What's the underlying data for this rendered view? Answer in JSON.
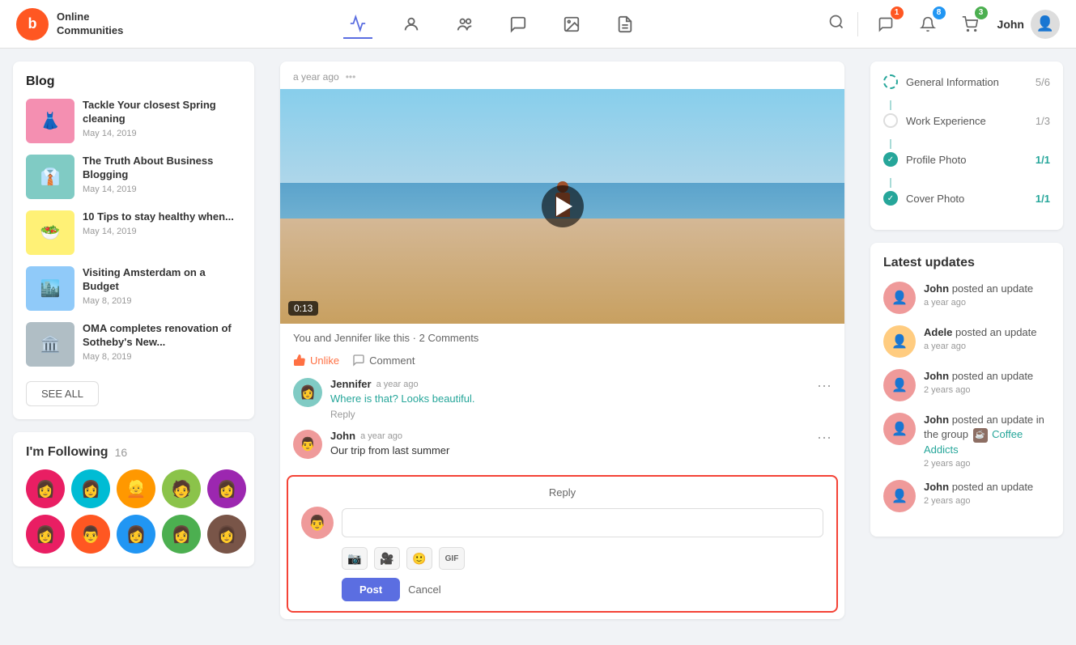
{
  "header": {
    "logo_text_line1": "Online",
    "logo_text_line2": "Communities",
    "logo_letter": "b",
    "user_name": "John",
    "badges": {
      "messages": "1",
      "notifications": "8",
      "cart": "3"
    }
  },
  "blog": {
    "title": "Blog",
    "items": [
      {
        "title": "Tackle Your closest Spring cleaning",
        "date": "May 14, 2019",
        "color": "pink"
      },
      {
        "title": "The Truth About Business Blogging",
        "date": "May 14, 2019",
        "color": "teal"
      },
      {
        "title": "10 Tips to stay healthy when...",
        "date": "May 14, 2019",
        "color": "yellow"
      },
      {
        "title": "Visiting Amsterdam on a Budget",
        "date": "May 8, 2019",
        "color": "blue"
      },
      {
        "title": "OMA completes renovation of Sotheby's New...",
        "date": "May 8, 2019",
        "color": "gray"
      }
    ],
    "see_all": "SEE ALL"
  },
  "following": {
    "title": "I'm Following",
    "count": "16"
  },
  "post": {
    "timestamp": "a year ago",
    "time_badge": "0:13",
    "like_text": "You and Jennifer like this · 2 Comments",
    "unlike_btn": "Unlike",
    "comment_btn": "Comment",
    "comments": [
      {
        "author": "Jennifer",
        "time": "a year ago",
        "text": "Where is that? Looks beautiful.",
        "reply": "Reply",
        "avatar_color": "teal"
      },
      {
        "author": "John",
        "time": "a year ago",
        "text": "Our trip from last summer",
        "avatar_color": "pink"
      }
    ],
    "reply": {
      "label": "Reply",
      "placeholder": "",
      "post_btn": "Post",
      "cancel_btn": "Cancel"
    }
  },
  "progress": {
    "items": [
      {
        "label": "General Information",
        "score": "5/6",
        "state": "partial"
      },
      {
        "label": "Work Experience",
        "score": "1/3",
        "state": "empty"
      },
      {
        "label": "Profile Photo",
        "score": "1/1",
        "state": "complete"
      },
      {
        "label": "Cover Photo",
        "score": "1/1",
        "state": "complete"
      }
    ]
  },
  "updates": {
    "title": "Latest updates",
    "items": [
      {
        "author": "John",
        "action": "posted an update",
        "time": "a year ago",
        "avatar": "ua1"
      },
      {
        "author": "Adele",
        "action": "posted an update",
        "time": "a year ago",
        "avatar": "ua2"
      },
      {
        "author": "John",
        "action": "posted an update",
        "time": "2 years ago",
        "avatar": "ua3"
      },
      {
        "author": "John",
        "action": "posted an update in the group",
        "group": "Coffee Addicts",
        "time": "2 years ago",
        "avatar": "ua4"
      },
      {
        "author": "John",
        "action": "posted an update",
        "time": "2 years ago",
        "avatar": "ua5"
      }
    ]
  }
}
